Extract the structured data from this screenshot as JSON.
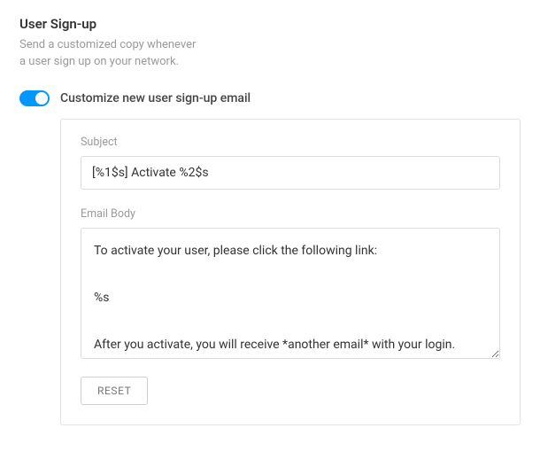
{
  "header": {
    "title": "User Sign-up",
    "description_line1": "Send a customized copy whenever",
    "description_line2": "a user sign up on your network."
  },
  "toggle": {
    "label": "Customize new user sign-up email",
    "on": true
  },
  "form": {
    "subject_label": "Subject",
    "subject_value": "[%1$s] Activate %2$s",
    "body_label": "Email Body",
    "body_value": "To activate your user, please click the following link:\n\n%s\n\nAfter you activate, you will receive *another email* with your login.",
    "reset_label": "RESET"
  }
}
